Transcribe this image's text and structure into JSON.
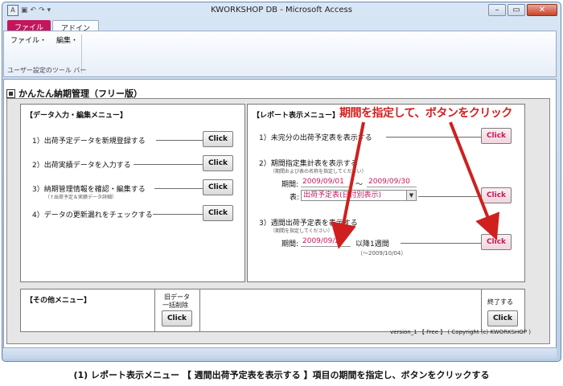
{
  "app": {
    "title": "KWORKSHOP DB - Microsoft Access",
    "tabs": [
      "ファイル",
      "アドイン"
    ],
    "menus": [
      "ファイル・",
      "編集・"
    ],
    "group_label": "ユーザー設定のツール バー",
    "win_buttons": [
      "–",
      "▭",
      "✕"
    ]
  },
  "form": {
    "title": "かんたん納期管理（フリー版）",
    "data_panel": {
      "title": "【データ入力・編集メニュー】",
      "rows": [
        {
          "label": "1）出荷予定データを新規登録する",
          "button": "Click"
        },
        {
          "label": "2）出荷実績データを入力する",
          "button": "Click"
        },
        {
          "label": "3）納期管理情報を確認・編集する",
          "note": "（↑出荷予定＆実績データ詳細）",
          "button": "Click"
        },
        {
          "label": "4）データの更新漏れをチェックする",
          "button": "Click"
        }
      ]
    },
    "report_panel": {
      "title": "【レポート表示メニュー】",
      "row1": {
        "label": "1）未完分の出荷予定表を表示する",
        "button": "Click"
      },
      "row2": {
        "label": "2）期間指定集計表を表示する",
        "note": "（期間および表の名称を指定してください）",
        "period_label": "期間:",
        "from": "2009/09/01",
        "tilde": "～",
        "to": "2009/09/30",
        "table_label": "表:",
        "table_value": "出荷予定表(日付別表示)",
        "button": "Click"
      },
      "row3": {
        "label": "3）週間出荷予定表を表示する",
        "note": "（期間を指定してください）",
        "period_label": "期間:",
        "date": "2009/09/28",
        "after": "以降1週間",
        "range_note": "（～2009/10/04）",
        "button": "Click"
      }
    },
    "other_panel": {
      "title": "【その他メニュー】"
    },
    "old_data": {
      "label_line1": "旧データ",
      "label_line2": "一括削除",
      "button": "Click"
    },
    "exit": {
      "label": "終了する",
      "button": "Click"
    },
    "version": "version_1 【 Free 】 ( Copyright (c) KWORKSHOP )"
  },
  "annotation": "期間を指定して、ボタンをクリック",
  "caption": "(1) レポート表示メニュー 【 週間出荷予定表を表示する 】項目の期間を指定し、ボタンをクリックする"
}
